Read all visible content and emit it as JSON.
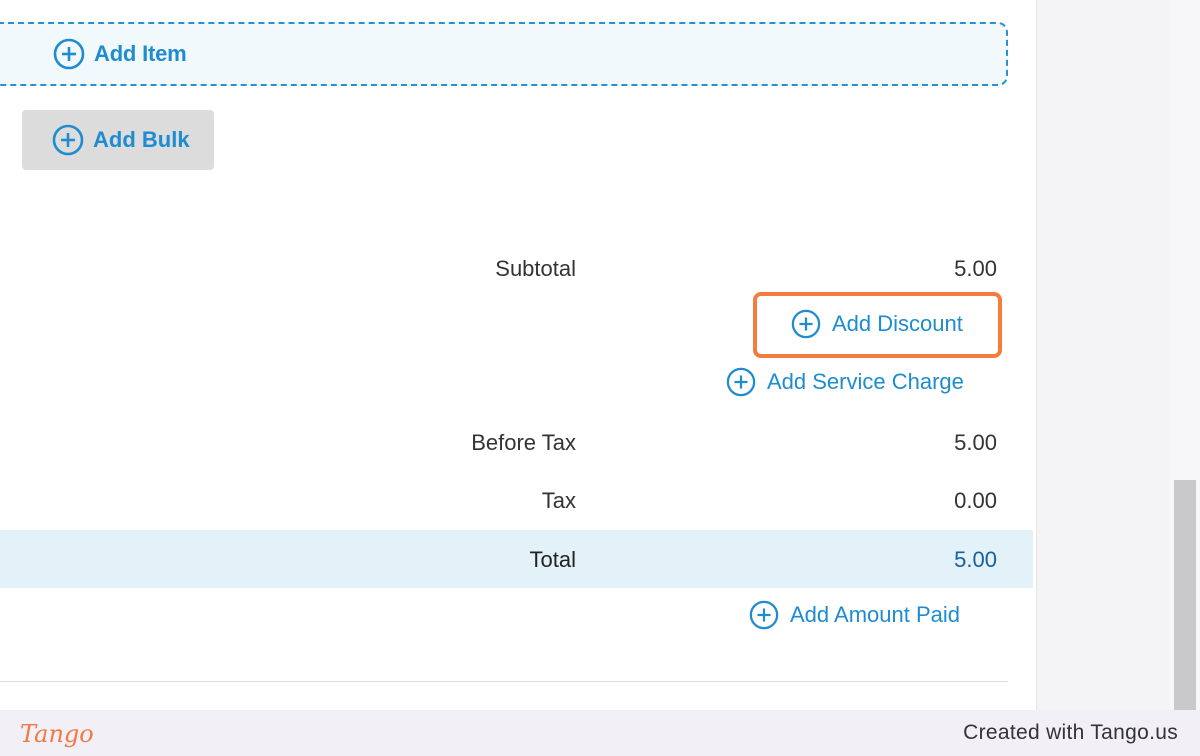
{
  "actions": {
    "add_item": "Add Item",
    "add_bulk": "Add Bulk",
    "add_discount": "Add Discount",
    "add_service_charge": "Add Service Charge",
    "add_amount_paid": "Add Amount Paid"
  },
  "summary": {
    "subtotal_label": "Subtotal",
    "subtotal_value": "5.00",
    "before_tax_label": "Before Tax",
    "before_tax_value": "5.00",
    "tax_label": "Tax",
    "tax_value": "0.00",
    "total_label": "Total",
    "total_value": "5.00"
  },
  "footer": {
    "logo": "Tango",
    "credit": "Created with Tango.us"
  },
  "icons": {
    "plus": "plus-circle-icon"
  },
  "colors": {
    "accent": "#1e8ccf",
    "highlight": "#f47c3c",
    "total_band": "#e3f1f9"
  }
}
